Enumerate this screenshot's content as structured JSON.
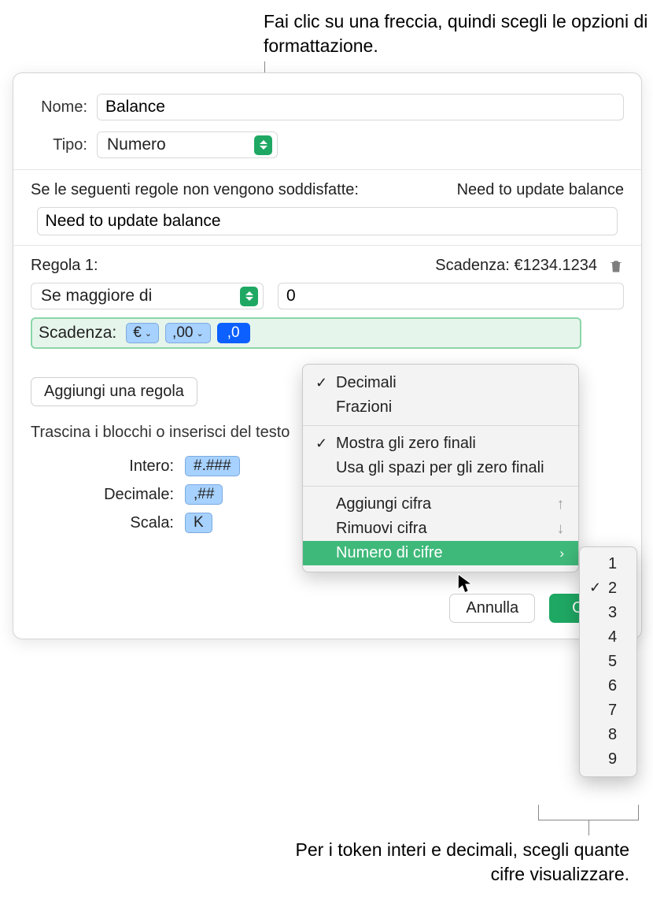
{
  "callouts": {
    "top": "Fai clic su una freccia, quindi scegli le opzioni di formattazione.",
    "bottom": "Per i token interi e decimali, scegli quante cifre visualizzare."
  },
  "form": {
    "name_label": "Nome:",
    "name_value": "Balance",
    "type_label": "Tipo:",
    "type_value": "Numero"
  },
  "rules_intro": {
    "text": "Se le seguenti regole non vengono soddisfatte:",
    "preview": "Need to update balance",
    "input_value": "Need to update balance"
  },
  "rule1": {
    "label": "Regola 1:",
    "preview_label": "Scadenza: €1234.1234",
    "condition": "Se maggiore di",
    "value": "0",
    "format_label": "Scadenza:",
    "token_currency": "€",
    "token_decimal_sep": ",00",
    "token_selected": ",0"
  },
  "add_rule": "Aggiungi una regola",
  "drag_hint": "Trascina i blocchi o inserisci del testo",
  "blocks": {
    "intero_label": "Intero:",
    "intero_value": "#.###",
    "decimale_label": "Decimale:",
    "decimale_value": ",##",
    "scala_label": "Scala:",
    "scala_value": "K"
  },
  "buttons": {
    "cancel": "Annulla",
    "ok": "OK"
  },
  "ctx": {
    "decimali": "Decimali",
    "frazioni": "Frazioni",
    "show_zero": "Mostra gli zero finali",
    "use_spaces": "Usa gli spazi per gli zero finali",
    "add_digit": "Aggiungi cifra",
    "remove_digit": "Rimuovi cifra",
    "digit_count": "Numero di cifre",
    "up_arrow": "↑",
    "down_arrow": "↓",
    "right_arrow": "›"
  },
  "submenu": {
    "items": [
      "1",
      "2",
      "3",
      "4",
      "5",
      "6",
      "7",
      "8",
      "9"
    ],
    "checked": "2"
  }
}
